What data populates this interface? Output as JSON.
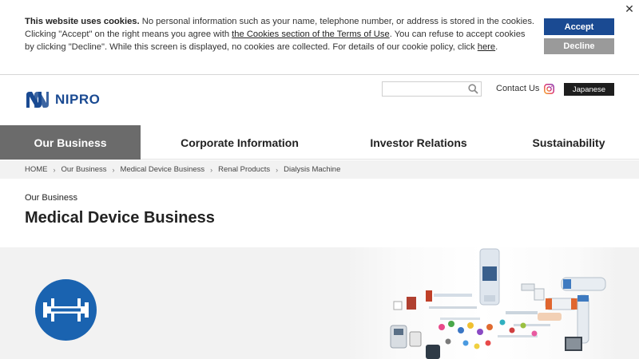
{
  "cookie": {
    "bold": "This website uses cookies.",
    "text1": " No personal information such as your name, telephone number, or address is stored in the cookies. Clicking \"Accept\" on the right means you agree with ",
    "link1": "the Cookies section of the Terms of Use",
    "text2": ". You can refuse to accept cookies by clicking \"Decline\". While this screen is displayed, no cookies are collected. For details of our cookie policy, click ",
    "link2": "here",
    "text3": ".",
    "accept_label": "Accept",
    "decline_label": "Decline",
    "close_glyph": "✕"
  },
  "header": {
    "logo_text": "NIPRO",
    "search_placeholder": "",
    "contact_label": "Contact Us",
    "lang_label": "Japanese"
  },
  "nav": {
    "items": [
      {
        "label": "Our Business",
        "active": true
      },
      {
        "label": "Corporate Information"
      },
      {
        "label": "Investor Relations"
      },
      {
        "label": "Sustainability"
      }
    ]
  },
  "breadcrumb": {
    "items": [
      "HOME",
      "Our Business",
      "Medical Device Business",
      "Renal Products",
      "Dialysis Machine"
    ],
    "separator": "›"
  },
  "main": {
    "eyebrow": "Our Business",
    "title": "Medical Device Business"
  },
  "colors": {
    "brand": "#1a4a92",
    "hero_icon": "#1a63b0",
    "nav_active": "#6b6b6b"
  },
  "icons": {
    "hero": "dialyzer-icon",
    "search": "search-icon",
    "social": "instagram-icon"
  }
}
